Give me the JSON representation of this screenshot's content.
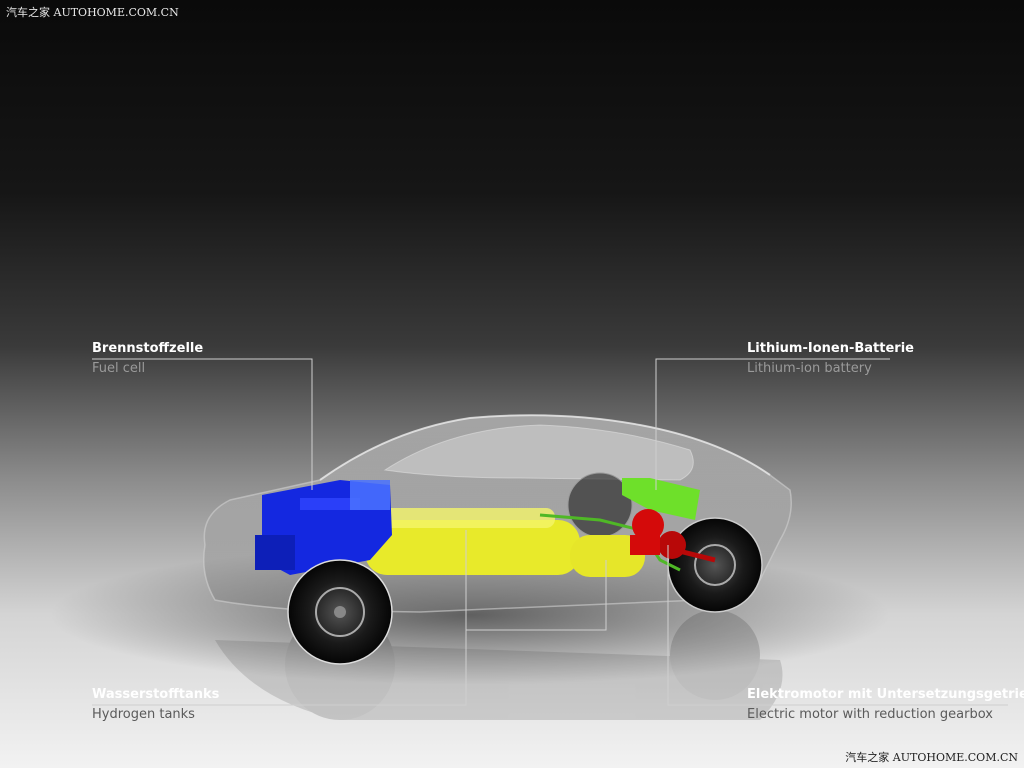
{
  "watermark": {
    "top": "汽车之家  AUTOHOME.COM.CN",
    "bottom": "汽车之家  AUTOHOME.COM.CN"
  },
  "labels": {
    "fuel_cell": {
      "de": "Brennstoffzelle",
      "en": "Fuel cell"
    },
    "battery": {
      "de": "Lithium-Ionen-Batterie",
      "en": "Lithium-ion battery"
    },
    "tanks": {
      "de": "Wasserstofftanks",
      "en": "Hydrogen tanks"
    },
    "motor": {
      "de": "Elektromotor mit Untersetzungsgetriebe",
      "en": "Electric motor with reduction gearbox"
    }
  },
  "colors": {
    "fuel_cell": "#1428e0",
    "tanks": "#e8ea2a",
    "battery": "#6ee02a",
    "motor": "#d40a0a",
    "leader": "#cfcfcf"
  }
}
